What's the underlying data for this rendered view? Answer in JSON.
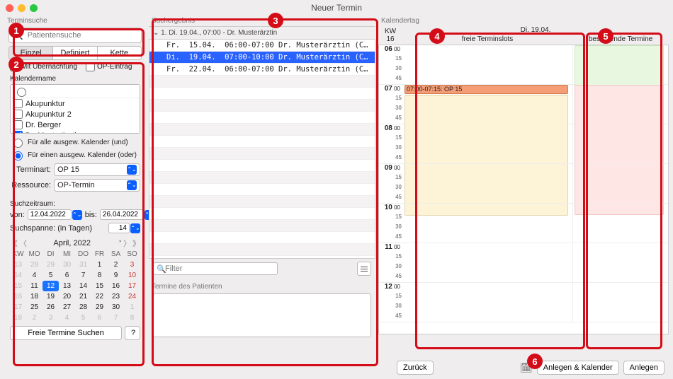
{
  "window_title": "Neuer Termin",
  "col1": {
    "search_label": "Terminsuche",
    "search_placeholder": "Patientensuche",
    "tabs": [
      "Einzel",
      "Definiert",
      "Kette"
    ],
    "chk_overnight": "Mit Übernachtung",
    "chk_op": "OP-Eintrag",
    "kalender_label": "Kalendername",
    "kalender_items": [
      "Akupunktur",
      "Akupunktur 2",
      "Dr. Berger",
      "Dr. Musterärztin"
    ],
    "radio_all": "Für alle ausgew. Kalender (und)",
    "radio_one": "Für einen ausgew. Kalender (oder)",
    "terminart_label": "Terminart:",
    "terminart_value": "OP 15",
    "ressource_label": "Ressource:",
    "ressource_value": "OP-Termin",
    "suchzeitraum": "Suchzeitraum:",
    "von": "von:",
    "von_value": "12.04.2022",
    "bis": "bis:",
    "bis_value": "26.04.2022",
    "spanne_label": "Suchspanne: (in Tagen)",
    "spanne_value": "14",
    "cal_month": "April, 2022",
    "cal_headers": [
      "KW",
      "MO",
      "DI",
      "MI",
      "DO",
      "FR",
      "SA",
      "SO"
    ],
    "cal_weeks": [
      {
        "kw": "13",
        "d": [
          "28",
          "29",
          "30",
          "31",
          "1",
          "2",
          "3"
        ]
      },
      {
        "kw": "14",
        "d": [
          "4",
          "5",
          "6",
          "7",
          "8",
          "9",
          "10"
        ]
      },
      {
        "kw": "15",
        "d": [
          "11",
          "12",
          "13",
          "14",
          "15",
          "16",
          "17"
        ]
      },
      {
        "kw": "16",
        "d": [
          "18",
          "19",
          "20",
          "21",
          "22",
          "23",
          "24"
        ]
      },
      {
        "kw": "17",
        "d": [
          "25",
          "26",
          "27",
          "28",
          "29",
          "30",
          "1"
        ]
      },
      {
        "kw": "18",
        "d": [
          "2",
          "3",
          "4",
          "5",
          "6",
          "7",
          "8"
        ]
      }
    ],
    "search_btn": "Freie Termine Suchen",
    "help_btn": "?"
  },
  "col2": {
    "label": "Suchergebnis",
    "group_header": "1. Di. 19.04., 07:00 - Dr. Musterärztin",
    "rows": [
      "Fr.  15.04.  06:00-07:00 Dr. Musterärztin (C…",
      "Di.  19.04.  07:00-10:00 Dr. Musterärztin (C…",
      "Fr.  22.04.  06:00-07:00 Dr. Musterärztin (C…"
    ],
    "filter_placeholder": "Filter",
    "patient_label": "Termine des Patienten"
  },
  "col3": {
    "label": "Kalendertag",
    "kw": "KW\n16",
    "date": "Di. 19.04.",
    "col_free": "freie Terminslots",
    "col_exist": "bestehende Termine",
    "hours": [
      "06",
      "07",
      "08",
      "09",
      "10",
      "11",
      "12"
    ],
    "quarter_ticks": [
      "15",
      "30",
      "45"
    ],
    "op_block": "07:00-07:15: OP 15",
    "btn_back": "Zurück",
    "btn_anlegen_kal": "Anlegen & Kalender",
    "btn_anlegen": "Anlegen"
  }
}
